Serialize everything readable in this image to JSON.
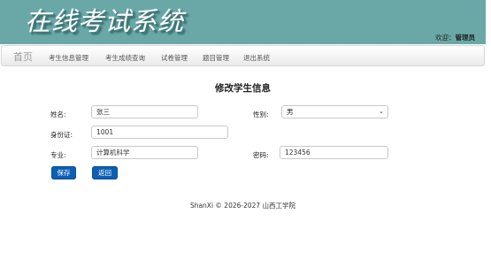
{
  "header": {
    "title": "在线考试系统",
    "welcome_label": "欢迎：",
    "user_name": "管理员"
  },
  "nav": {
    "brand": "首页",
    "items": [
      {
        "label": "考生信息管理"
      },
      {
        "label": "考生成绩查询"
      },
      {
        "label": "试卷管理"
      },
      {
        "label": "题目管理"
      },
      {
        "label": "退出系统"
      }
    ]
  },
  "form": {
    "title": "修改学生信息",
    "name_label": "姓名:",
    "name_value": "张三",
    "gender_label": "性别:",
    "gender_value": "男",
    "id_label": "身份证:",
    "id_value": "1001",
    "major_label": "专业:",
    "major_value": "计算机科学",
    "password_label": "密码:",
    "password_value": "123456",
    "save_label": "保存",
    "back_label": "返回"
  },
  "footer": {
    "text": "ShanXi © 2026-2027 山西工学院"
  },
  "colors": {
    "banner": "#6aa8a8",
    "button": "#0d5fb3"
  }
}
